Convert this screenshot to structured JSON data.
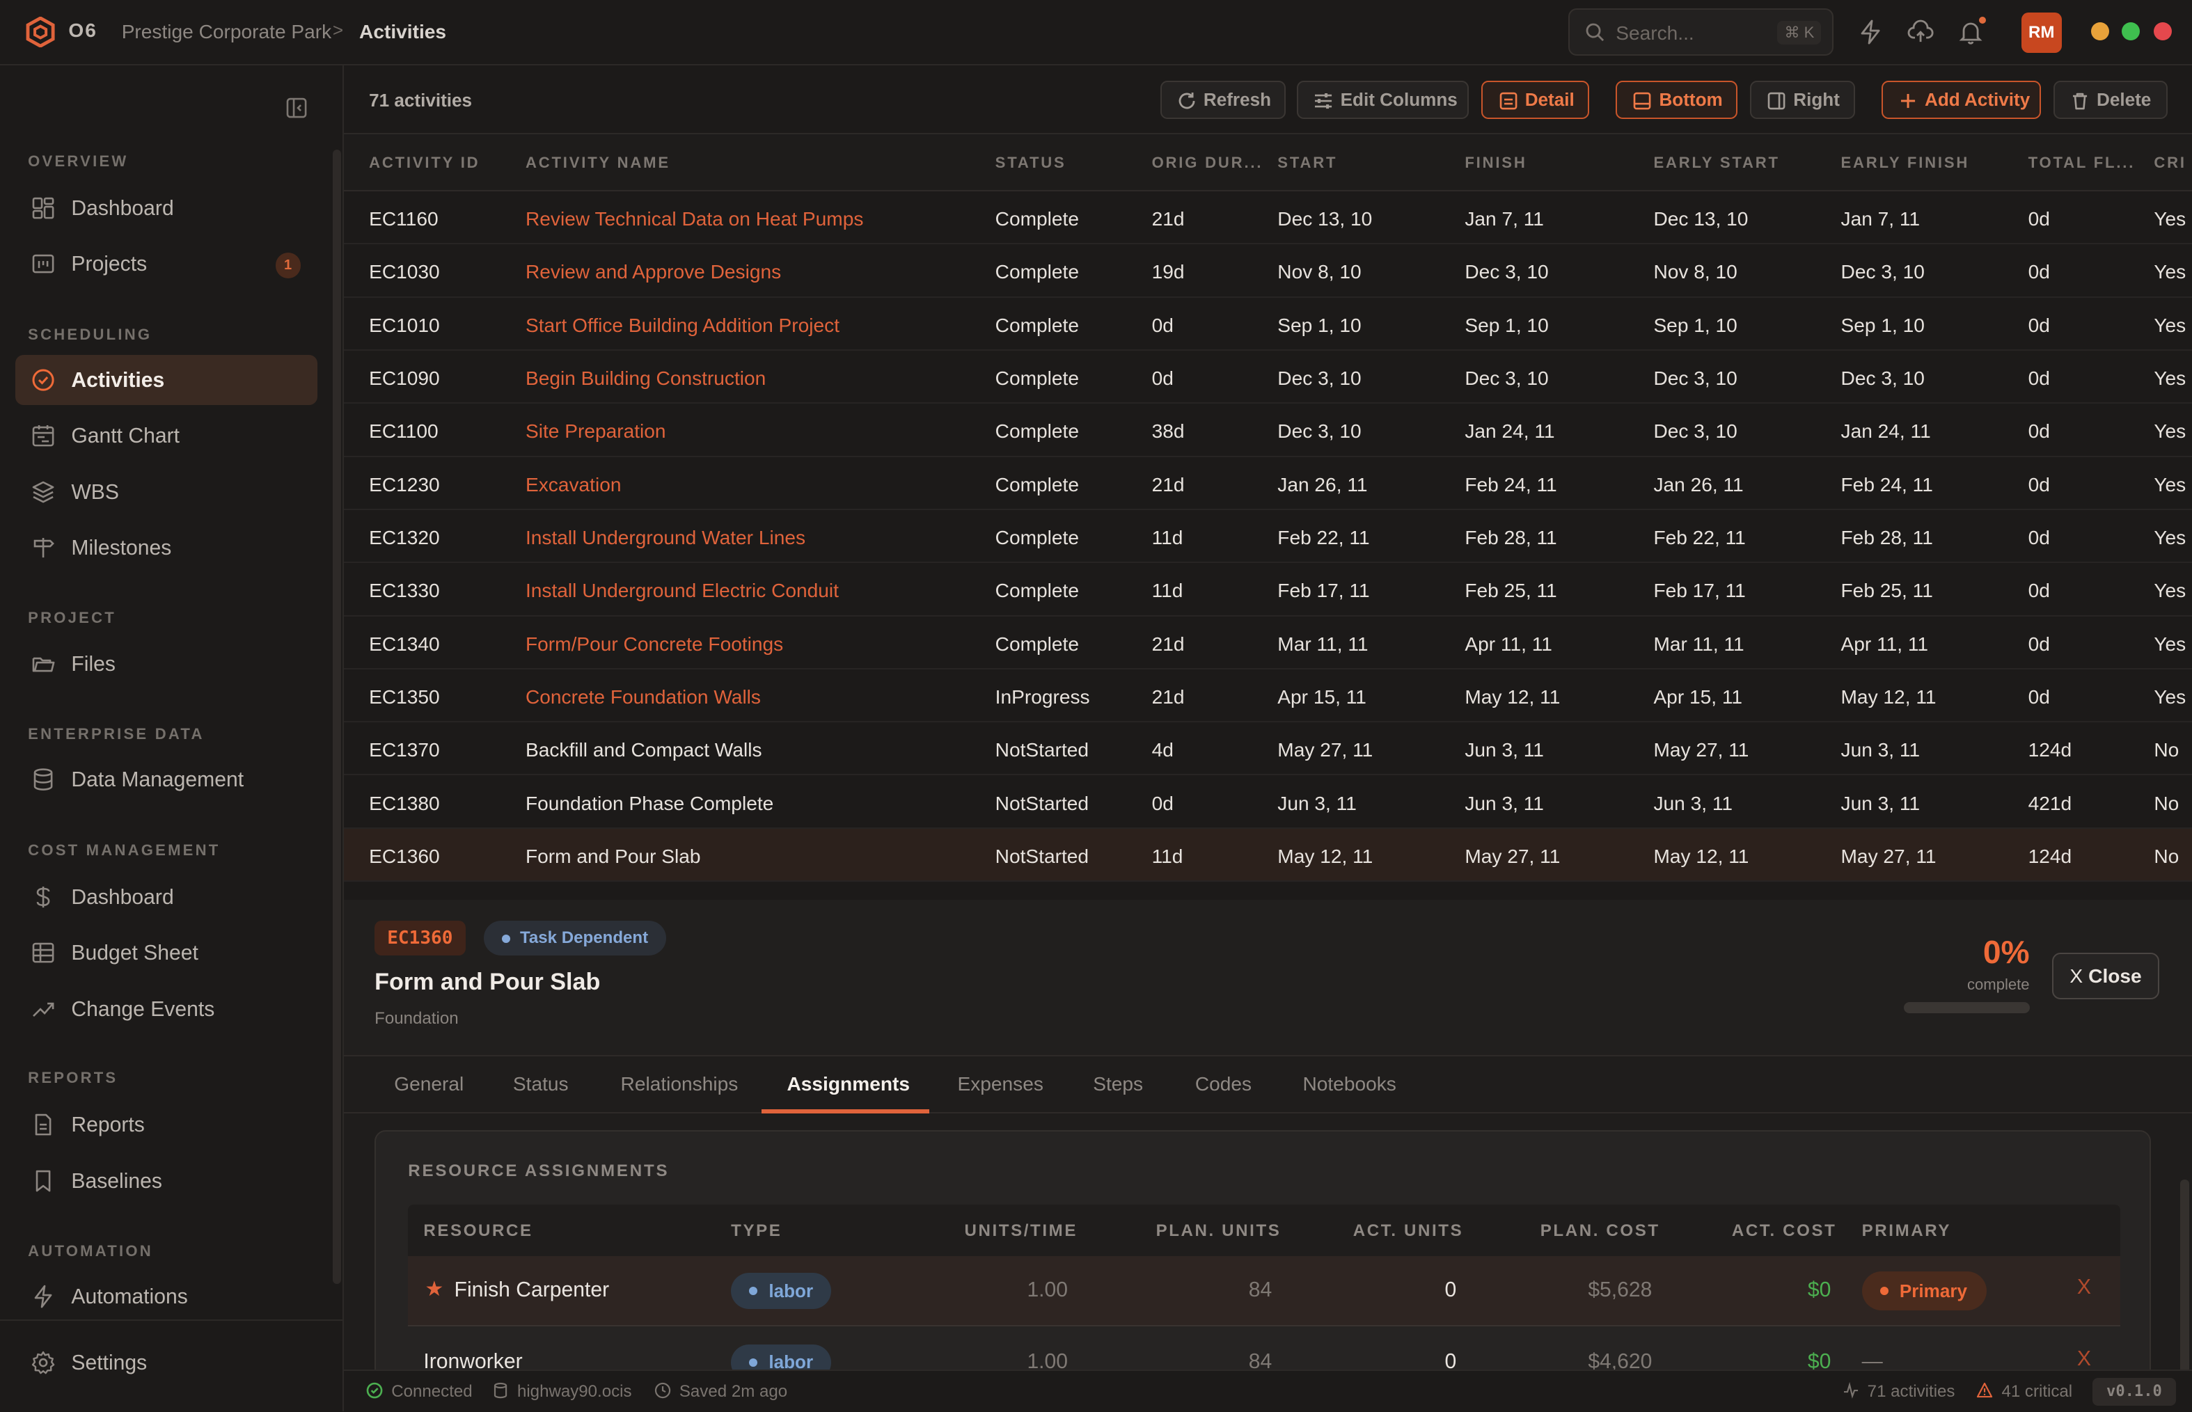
{
  "header": {
    "brand": "O6",
    "breadcrumb_project": "Prestige Corporate Park",
    "breadcrumb_sep": ">",
    "breadcrumb_page": "Activities",
    "search_placeholder": "Search...",
    "search_shortcut": "⌘ K",
    "avatar_initials": "RM",
    "window_dots": [
      "#e8a23a",
      "#3fbf4f",
      "#e5484d"
    ]
  },
  "sidebar": {
    "sections": {
      "overview": "OVERVIEW",
      "scheduling": "SCHEDULING",
      "project": "PROJECT",
      "enterprise": "ENTERPRISE DATA",
      "cost": "COST MANAGEMENT",
      "reports": "REPORTS",
      "automation": "AUTOMATION"
    },
    "items": {
      "dashboard": "Dashboard",
      "projects": "Projects",
      "projects_badge": "1",
      "activities": "Activities",
      "gantt": "Gantt Chart",
      "wbs": "WBS",
      "milestones": "Milestones",
      "files": "Files",
      "data_management": "Data Management",
      "cost_dashboard": "Dashboard",
      "budget_sheet": "Budget Sheet",
      "change_events": "Change Events",
      "reports": "Reports",
      "baselines": "Baselines",
      "automations": "Automations",
      "settings": "Settings"
    }
  },
  "toolbar": {
    "count": "71 activities",
    "refresh": "Refresh",
    "edit_columns": "Edit Columns",
    "detail": "Detail",
    "bottom": "Bottom",
    "right": "Right",
    "add_activity": "Add Activity",
    "delete": "Delete"
  },
  "grid": {
    "columns": [
      "ACTIVITY ID",
      "ACTIVITY NAME",
      "STATUS",
      "ORIG DUR...",
      "START",
      "FINISH",
      "EARLY START",
      "EARLY FINISH",
      "TOTAL FL...",
      "CRI"
    ],
    "rows": [
      [
        "EC1160",
        "Review Technical Data on Heat Pumps",
        "Complete",
        "21d",
        "Dec 13, 10",
        "Jan 7, 11",
        "Dec 13, 10",
        "Jan 7, 11",
        "0d",
        "Yes"
      ],
      [
        "EC1030",
        "Review and Approve Designs",
        "Complete",
        "19d",
        "Nov 8, 10",
        "Dec 3, 10",
        "Nov 8, 10",
        "Dec 3, 10",
        "0d",
        "Yes"
      ],
      [
        "EC1010",
        "Start Office Building Addition Project",
        "Complete",
        "0d",
        "Sep 1, 10",
        "Sep 1, 10",
        "Sep 1, 10",
        "Sep 1, 10",
        "0d",
        "Yes"
      ],
      [
        "EC1090",
        "Begin Building Construction",
        "Complete",
        "0d",
        "Dec 3, 10",
        "Dec 3, 10",
        "Dec 3, 10",
        "Dec 3, 10",
        "0d",
        "Yes"
      ],
      [
        "EC1100",
        "Site Preparation",
        "Complete",
        "38d",
        "Dec 3, 10",
        "Jan 24, 11",
        "Dec 3, 10",
        "Jan 24, 11",
        "0d",
        "Yes"
      ],
      [
        "EC1230",
        "Excavation",
        "Complete",
        "21d",
        "Jan 26, 11",
        "Feb 24, 11",
        "Jan 26, 11",
        "Feb 24, 11",
        "0d",
        "Yes"
      ],
      [
        "EC1320",
        "Install Underground Water Lines",
        "Complete",
        "11d",
        "Feb 22, 11",
        "Feb 28, 11",
        "Feb 22, 11",
        "Feb 28, 11",
        "0d",
        "Yes"
      ],
      [
        "EC1330",
        "Install Underground Electric Conduit",
        "Complete",
        "11d",
        "Feb 17, 11",
        "Feb 25, 11",
        "Feb 17, 11",
        "Feb 25, 11",
        "0d",
        "Yes"
      ],
      [
        "EC1340",
        "Form/Pour Concrete Footings",
        "Complete",
        "21d",
        "Mar 11, 11",
        "Apr 11, 11",
        "Mar 11, 11",
        "Apr 11, 11",
        "0d",
        "Yes"
      ],
      [
        "EC1350",
        "Concrete Foundation Walls",
        "InProgress",
        "21d",
        "Apr 15, 11",
        "May 12, 11",
        "Apr 15, 11",
        "May 12, 11",
        "0d",
        "Yes"
      ],
      [
        "EC1370",
        "Backfill and Compact Walls",
        "NotStarted",
        "4d",
        "May 27, 11",
        "Jun 3, 11",
        "May 27, 11",
        "Jun 3, 11",
        "124d",
        "No"
      ],
      [
        "EC1380",
        "Foundation Phase Complete",
        "NotStarted",
        "0d",
        "Jun 3, 11",
        "Jun 3, 11",
        "Jun 3, 11",
        "Jun 3, 11",
        "421d",
        "No"
      ],
      [
        "EC1360",
        "Form and Pour Slab",
        "NotStarted",
        "11d",
        "May 12, 11",
        "May 27, 11",
        "May 12, 11",
        "May 27, 11",
        "124d",
        "No"
      ]
    ]
  },
  "detail": {
    "id": "EC1360",
    "type": "Task Dependent",
    "title": "Form and Pour Slab",
    "wbs": "Foundation",
    "percent": "0%",
    "percent_label": "complete",
    "percent_value": 0,
    "close": "Close",
    "tabs": [
      "General",
      "Status",
      "Relationships",
      "Assignments",
      "Expenses",
      "Steps",
      "Codes",
      "Notebooks"
    ],
    "active_tab": "Assignments",
    "panel_title": "RESOURCE ASSIGNMENTS",
    "columns": [
      "RESOURCE",
      "TYPE",
      "UNITS/TIME",
      "PLAN. UNITS",
      "ACT. UNITS",
      "PLAN. COST",
      "ACT. COST",
      "PRIMARY"
    ],
    "assignments": [
      {
        "resource": "Finish Carpenter",
        "type": "labor",
        "units_time": "1.00",
        "plan_units": "84",
        "act_units": "0",
        "plan_cost": "$5,628",
        "act_cost": "$0",
        "primary": "Primary",
        "remove": "X"
      },
      {
        "resource": "Ironworker",
        "type": "labor",
        "units_time": "1.00",
        "plan_units": "84",
        "act_units": "0",
        "plan_cost": "$4,620",
        "act_cost": "$0",
        "primary": "—",
        "remove": "X"
      }
    ]
  },
  "statusbar": {
    "connection": "Connected",
    "database": "highway90.ocis",
    "saved": "Saved 2m ago",
    "activities": "71 activities",
    "critical": "41 critical",
    "version": "v0.1.0"
  },
  "colors": {
    "accent": "#e0633b",
    "success": "#4caf50",
    "info": "#86a9d9"
  }
}
